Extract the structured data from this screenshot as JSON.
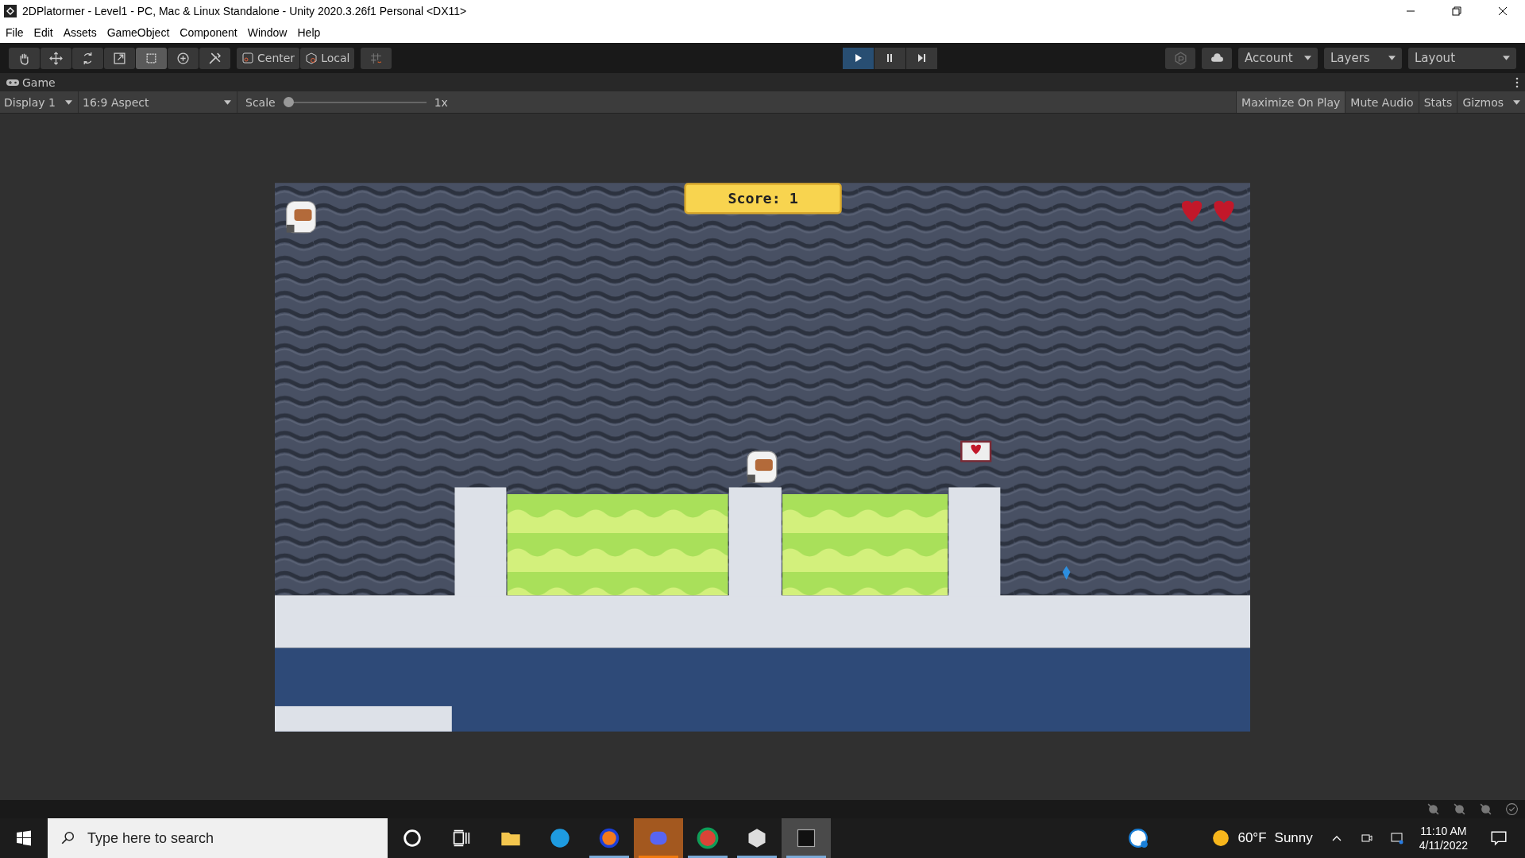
{
  "window": {
    "title": "2DPlatormer - Level1 - PC, Mac & Linux Standalone - Unity 2020.3.26f1 Personal <DX11>"
  },
  "menu": [
    "File",
    "Edit",
    "Assets",
    "GameObject",
    "Component",
    "Window",
    "Help"
  ],
  "tools": [
    {
      "kind": "hand",
      "selected": false
    },
    {
      "kind": "move",
      "selected": false
    },
    {
      "kind": "rotate",
      "selected": false
    },
    {
      "kind": "scale",
      "selected": false
    },
    {
      "kind": "rect",
      "selected": true
    },
    {
      "kind": "transform",
      "selected": false
    },
    {
      "kind": "custom",
      "selected": false
    }
  ],
  "pivot": [
    {
      "label": "Center",
      "kind": "center"
    },
    {
      "label": "Local",
      "kind": "local"
    }
  ],
  "playback": [
    {
      "kind": "play",
      "on": true
    },
    {
      "kind": "pause",
      "on": false
    },
    {
      "kind": "step",
      "on": false
    }
  ],
  "dropdowns": [
    "Account",
    "Layers",
    "Layout"
  ],
  "game_tab": {
    "label": "Game"
  },
  "game_toolbar": {
    "display": "Display 1",
    "aspect": "16:9 Aspect",
    "scale_label": "Scale",
    "scale": {
      "level": 0
    },
    "scale_reading": "1x",
    "toggles": [
      {
        "label": "Maximize On Play",
        "selected": true
      },
      {
        "label": "Mute Audio",
        "selected": false
      },
      {
        "label": "Stats",
        "selected": false
      },
      {
        "label": "Gizmos",
        "selected": false
      }
    ]
  },
  "game": {
    "score": "Score: 1"
  },
  "taskbar": {
    "search": {
      "placeholder": "Type here to search"
    },
    "apps": [
      {
        "kind": "cortana",
        "flashing": false,
        "focused": false,
        "running": false
      },
      {
        "kind": "taskview",
        "flashing": false,
        "focused": false,
        "running": false
      },
      {
        "kind": "explorer",
        "flashing": false,
        "focused": false,
        "running": false
      },
      {
        "kind": "edge",
        "flashing": false,
        "focused": false,
        "running": false
      },
      {
        "kind": "audacity",
        "flashing": false,
        "focused": false,
        "running": true
      },
      {
        "kind": "discord",
        "flashing": true,
        "focused": false,
        "running": true
      },
      {
        "kind": "chrome",
        "flashing": false,
        "focused": false,
        "running": true
      },
      {
        "kind": "unityhub",
        "flashing": false,
        "focused": false,
        "running": true
      },
      {
        "kind": "unity",
        "flashing": false,
        "focused": true,
        "running": true
      }
    ],
    "temperature": "60°F",
    "weather": "Sunny",
    "time": "11:10 AM",
    "date": "4/11/2022"
  }
}
